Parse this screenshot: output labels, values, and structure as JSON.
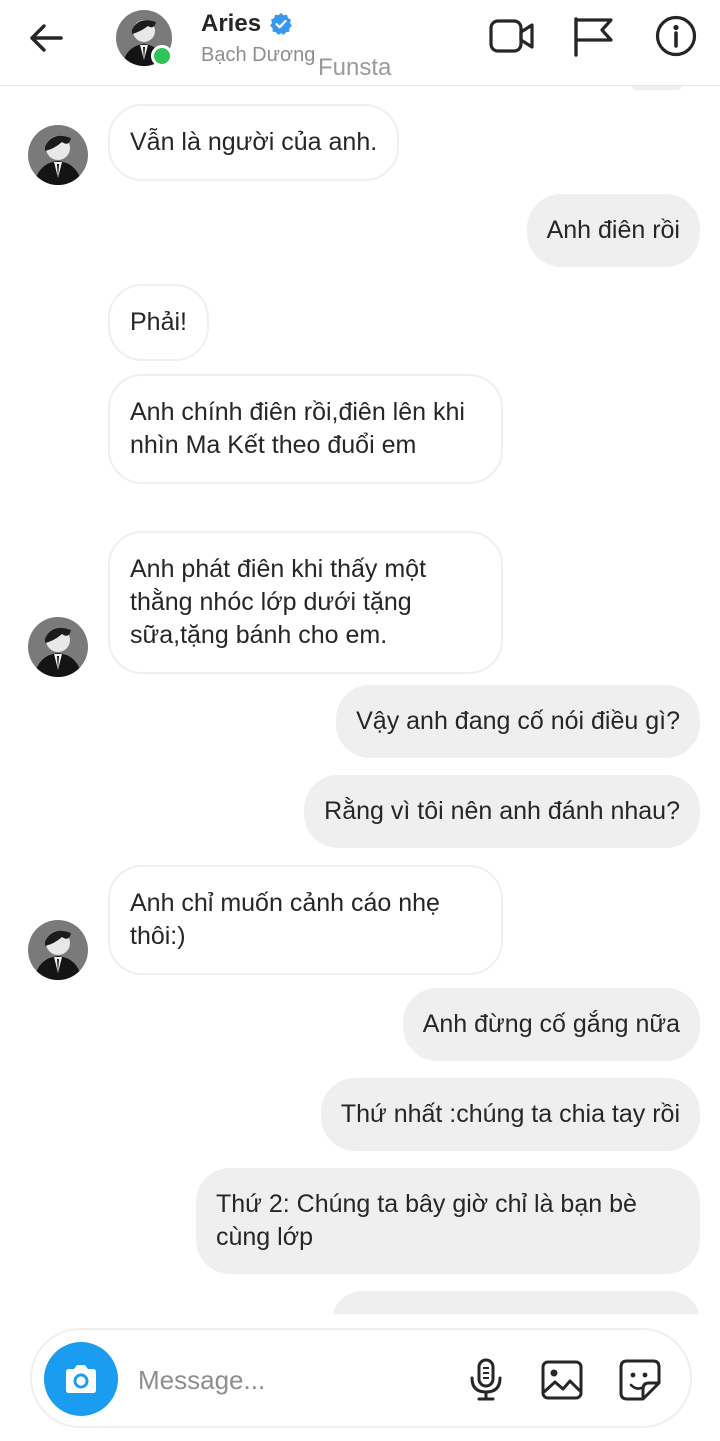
{
  "header": {
    "name": "Aries",
    "subtitle": "Bạch Dương",
    "watermark": "Funsta"
  },
  "icons": {
    "back": "arrow-left-icon",
    "verified": "verified-badge-icon",
    "video": "video-call-icon",
    "flag": "flag-icon",
    "info": "info-icon",
    "camera": "camera-icon",
    "mic": "microphone-icon",
    "gallery": "gallery-icon",
    "sticker": "sticker-icon"
  },
  "colors": {
    "accent": "#1a9cf0",
    "online": "#2ec45a",
    "verified": "#3897f0",
    "outgoing_bubble": "#efefef",
    "incoming_border": "#efefef"
  },
  "messages": [
    {
      "direction": "in",
      "text": "Vẫn là người của anh."
    },
    {
      "direction": "out",
      "text": "Anh điên rồi"
    },
    {
      "direction": "in",
      "text": "Phải!"
    },
    {
      "direction": "in",
      "text": "Anh chính điên rồi,điên lên khi nhìn Ma Kết theo đuổi em"
    },
    {
      "direction": "in",
      "text": "Anh phát điên khi thấy một thằng nhóc lớp dưới tặng sữa,tặng bánh cho em."
    },
    {
      "direction": "out",
      "text": "Vậy anh đang cố nói điều gì?"
    },
    {
      "direction": "out",
      "text": "Rằng vì tôi nên anh đánh nhau?"
    },
    {
      "direction": "in",
      "text": "Anh chỉ muốn cảnh cáo nhẹ thôi:)"
    },
    {
      "direction": "out",
      "text": "Anh đừng cố gắng nữa"
    },
    {
      "direction": "out",
      "text": "Thứ nhất :chúng ta chia tay rồi"
    },
    {
      "direction": "out",
      "text": "Thứ 2: Chúng ta bây giờ chỉ là bạn bè cùng lớp"
    }
  ],
  "composer": {
    "placeholder": "Message..."
  }
}
